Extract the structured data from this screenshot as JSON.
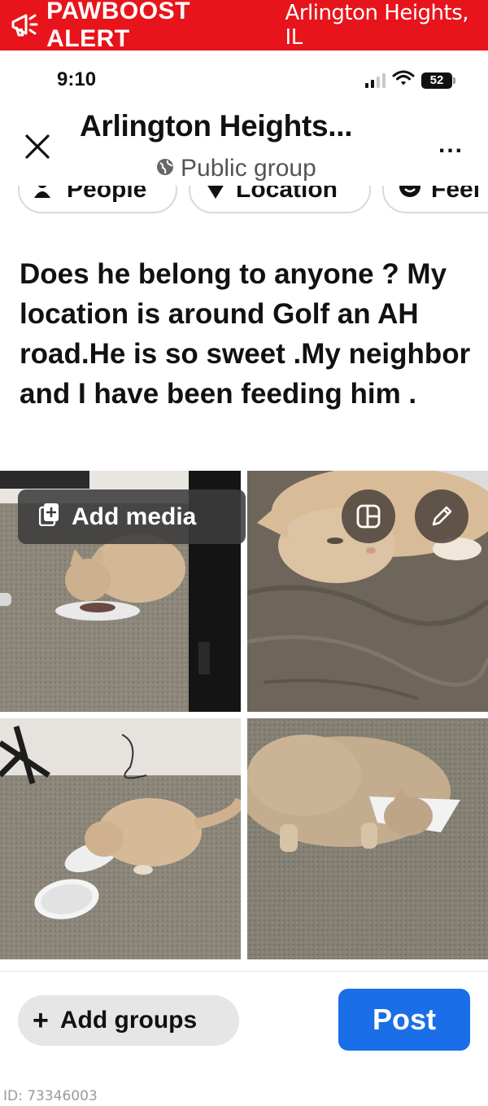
{
  "banner": {
    "brand": "PAWBOOST ALERT",
    "location": "Arlington Heights, IL",
    "icon": "megaphone-icon",
    "color": "#e8141b"
  },
  "status_bar": {
    "time": "9:10",
    "battery": "52",
    "icons": [
      "cellular-signal-icon",
      "wifi-icon",
      "battery-icon"
    ]
  },
  "header": {
    "group_name": "Arlington Heights...",
    "privacy": "Public group",
    "close_icon": "close-icon",
    "more_icon": "more-icon",
    "more_label": "..."
  },
  "chips": [
    {
      "label": "People",
      "icon": "tag-people-icon"
    },
    {
      "label": "Location",
      "icon": "location-pin-icon"
    },
    {
      "label": "Feel",
      "icon": "smile-icon"
    }
  ],
  "post": {
    "text": "Does he belong to anyone ? My location is around Golf an AH road.He is so sweet .My neighbor and I have been feeding him ."
  },
  "media": {
    "add_media_label": "Add media",
    "layout_icon": "layout-icon",
    "edit_icon": "pencil-icon"
  },
  "footer": {
    "add_groups_label": "Add groups",
    "plus_label": "+",
    "post_label": "Post",
    "post_color": "#1a6ee8"
  },
  "listing_id": "ID: 73346003"
}
